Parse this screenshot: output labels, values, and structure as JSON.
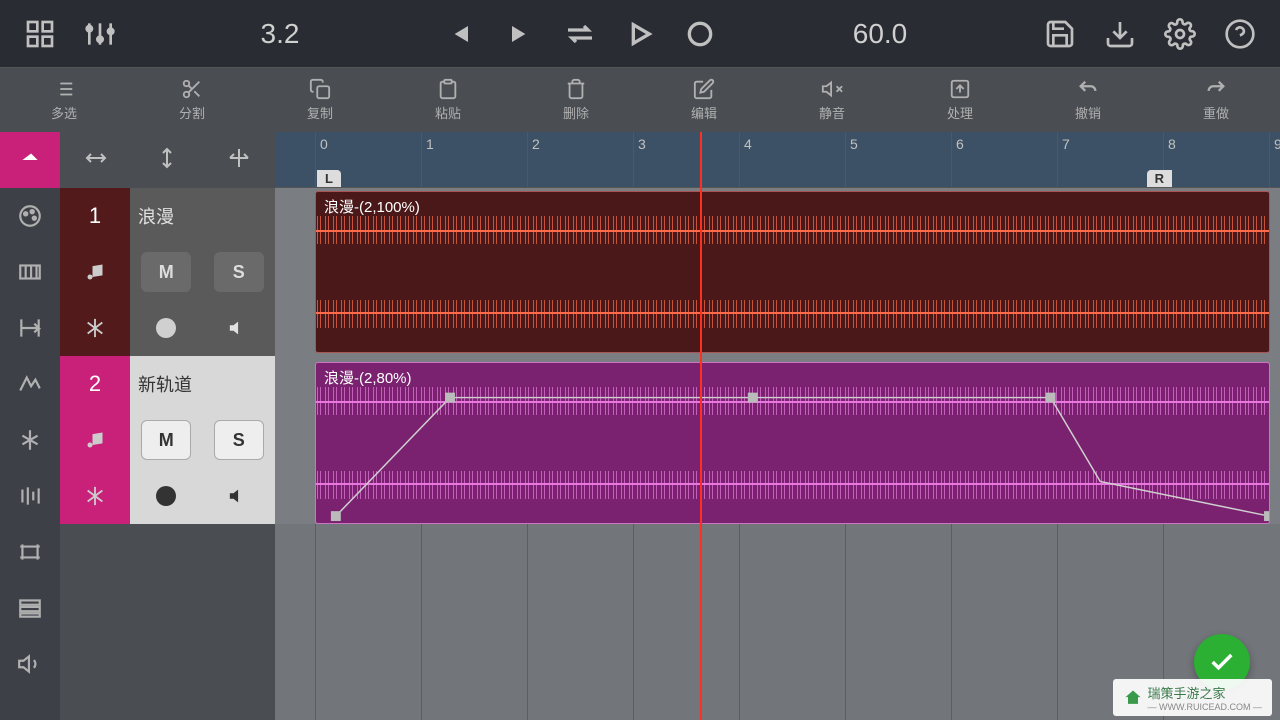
{
  "topbar": {
    "position": "3.2",
    "tempo": "60.0"
  },
  "subbar": {
    "multiselect": "多选",
    "split": "分割",
    "copy": "复制",
    "paste": "粘贴",
    "delete": "删除",
    "edit": "编辑",
    "mute": "静音",
    "process": "处理",
    "undo": "撤销",
    "redo": "重做"
  },
  "ruler": {
    "ticks": [
      "0",
      "1",
      "2",
      "3",
      "4",
      "5",
      "6",
      "7",
      "8",
      "9"
    ],
    "left_marker": "L",
    "right_marker": "R"
  },
  "tracks": [
    {
      "num": "1",
      "name": "浪漫",
      "mute": "M",
      "solo": "S",
      "clip_label": "浪漫-(2,100%)"
    },
    {
      "num": "2",
      "name": "新轨道",
      "mute": "M",
      "solo": "S",
      "clip_label": "浪漫-(2,80%)"
    }
  ],
  "watermark": {
    "title": "瑞策手游之家",
    "sub": "— WWW.RUICEAD.COM —"
  }
}
